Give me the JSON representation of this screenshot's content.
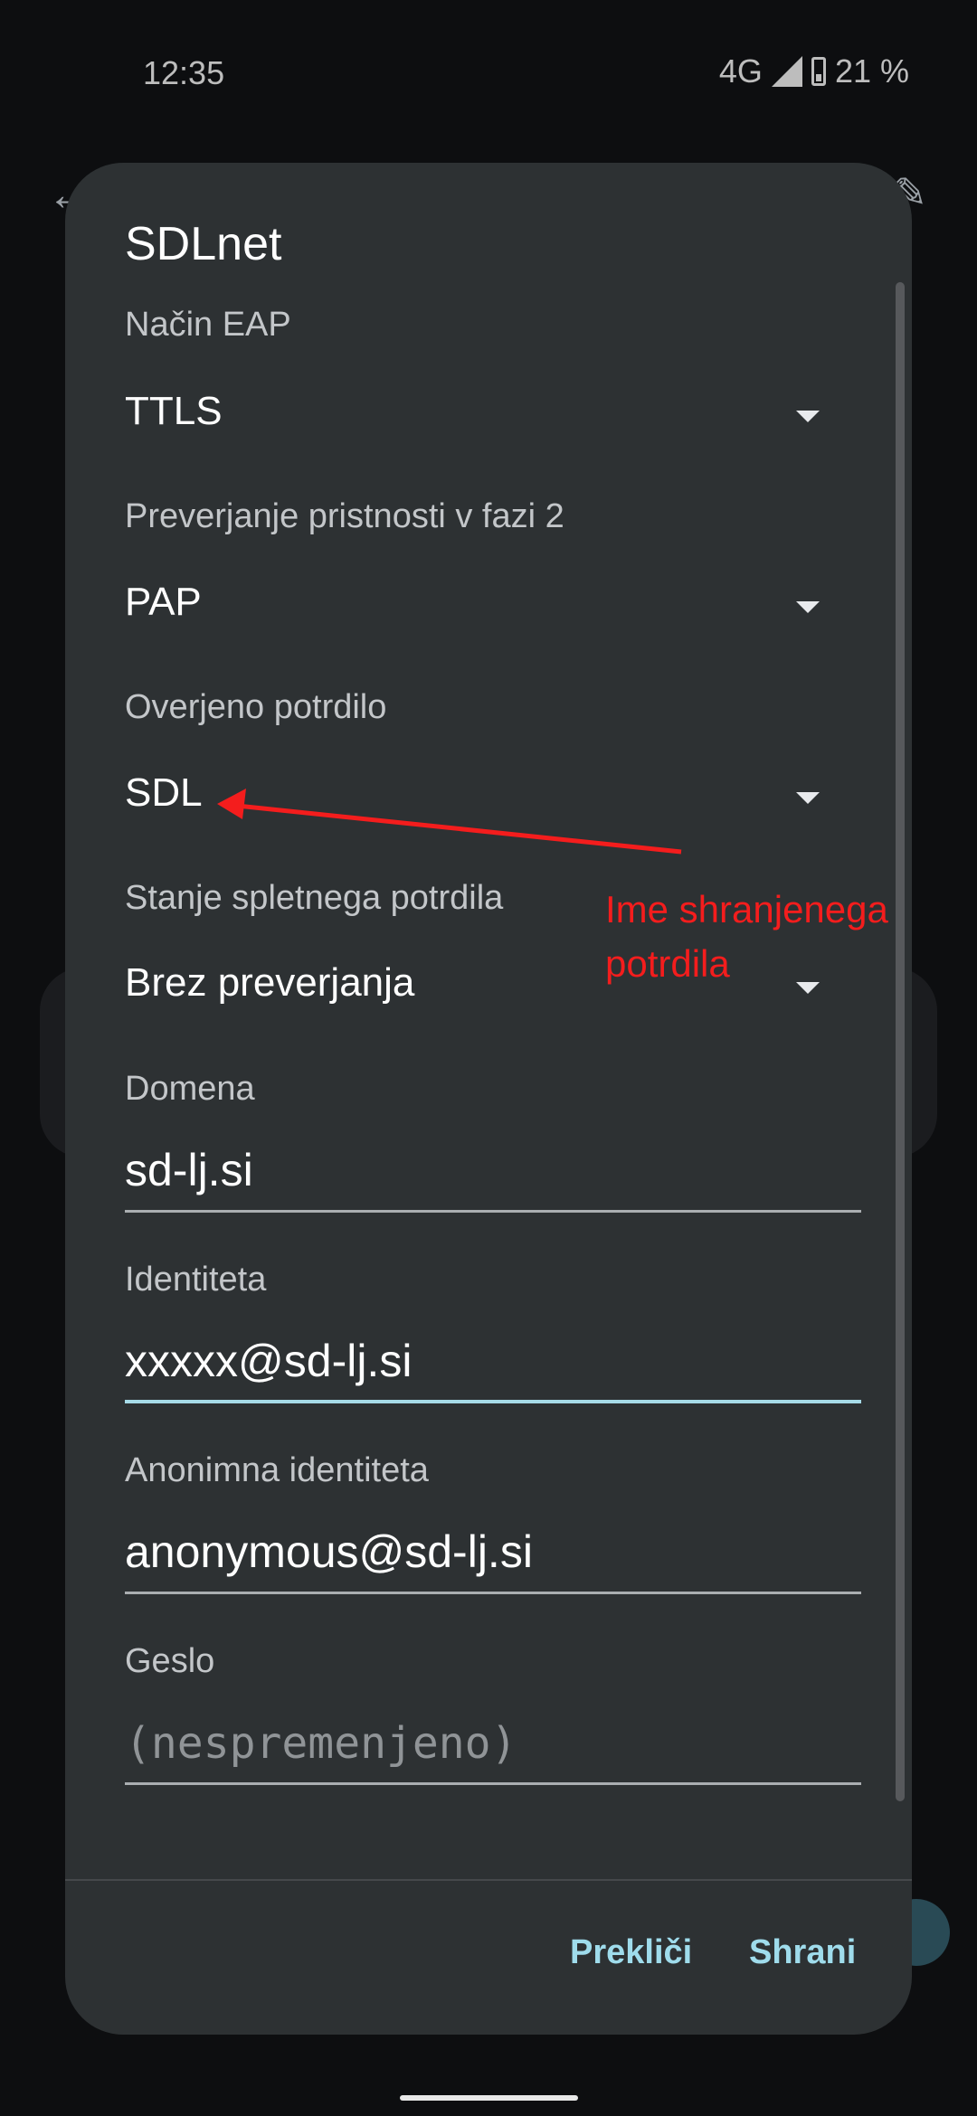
{
  "status_bar": {
    "time": "12:35",
    "network": "4G",
    "battery": "21 %",
    "icons": [
      "signal-icon",
      "battery-icon"
    ]
  },
  "background": {
    "icons": [
      "arrow-back-icon",
      "edit-pencil-icon"
    ]
  },
  "dialog": {
    "title": "SDLnet",
    "fields": {
      "eap_method": {
        "label": "Način EAP",
        "value": "TTLS"
      },
      "phase2_auth": {
        "label": "Preverjanje pristnosti v fazi 2",
        "value": "PAP"
      },
      "ca_certificate": {
        "label": "Overjeno potrdilo",
        "value": "SDL"
      },
      "online_cert_status": {
        "label": "Stanje spletnega potrdila",
        "value": "Brez preverjanja"
      },
      "domain": {
        "label": "Domena",
        "value": "sd-lj.si"
      },
      "identity": {
        "label": "Identiteta",
        "value": "xxxxx@sd-lj.si"
      },
      "anonymous_identity": {
        "label": "Anonimna identiteta",
        "value": "anonymous@sd-lj.si"
      },
      "password": {
        "label": "Geslo",
        "placeholder": "(nespremenjeno)"
      }
    },
    "actions": {
      "cancel": "Prekliči",
      "save": "Shrani"
    }
  },
  "annotation": {
    "line1": "Ime shranjenega",
    "line2": "potrdila",
    "color": "#f41d1d"
  },
  "colors": {
    "dialog_bg": "#2d3133",
    "accent": "#9fdcec",
    "focused_underline": "#a6dbe8"
  }
}
